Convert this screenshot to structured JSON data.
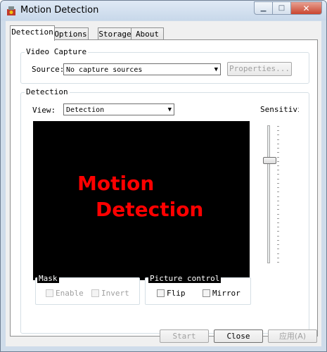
{
  "window": {
    "title": "Motion Detection"
  },
  "tabs": [
    {
      "label": "Detection",
      "active": true
    },
    {
      "label": "Options",
      "active": false
    },
    {
      "label": "Storage",
      "active": false
    },
    {
      "label": "About",
      "active": false
    }
  ],
  "video_capture": {
    "group_label": "Video Capture",
    "source_label": "Source:",
    "source_value": "No capture sources",
    "properties_button": "Properties..."
  },
  "detection": {
    "group_label": "Detection",
    "view_label": "View:",
    "view_value": "Detection",
    "sensitivity_label": "Sensitivi",
    "sensitivity_fraction": 0.24,
    "video_line1": "Motion",
    "video_line2": "Detection",
    "video_text_color": "#ff0000"
  },
  "mask": {
    "label": "Mask",
    "enable_label": "Enable",
    "invert_label": "Invert"
  },
  "picture_control": {
    "label": "Picture control",
    "flip_label": "Flip",
    "mirror_label": "Mirror"
  },
  "footer": {
    "start_button": "Start",
    "close_button": "Close",
    "apply_button": "应用(A)"
  }
}
